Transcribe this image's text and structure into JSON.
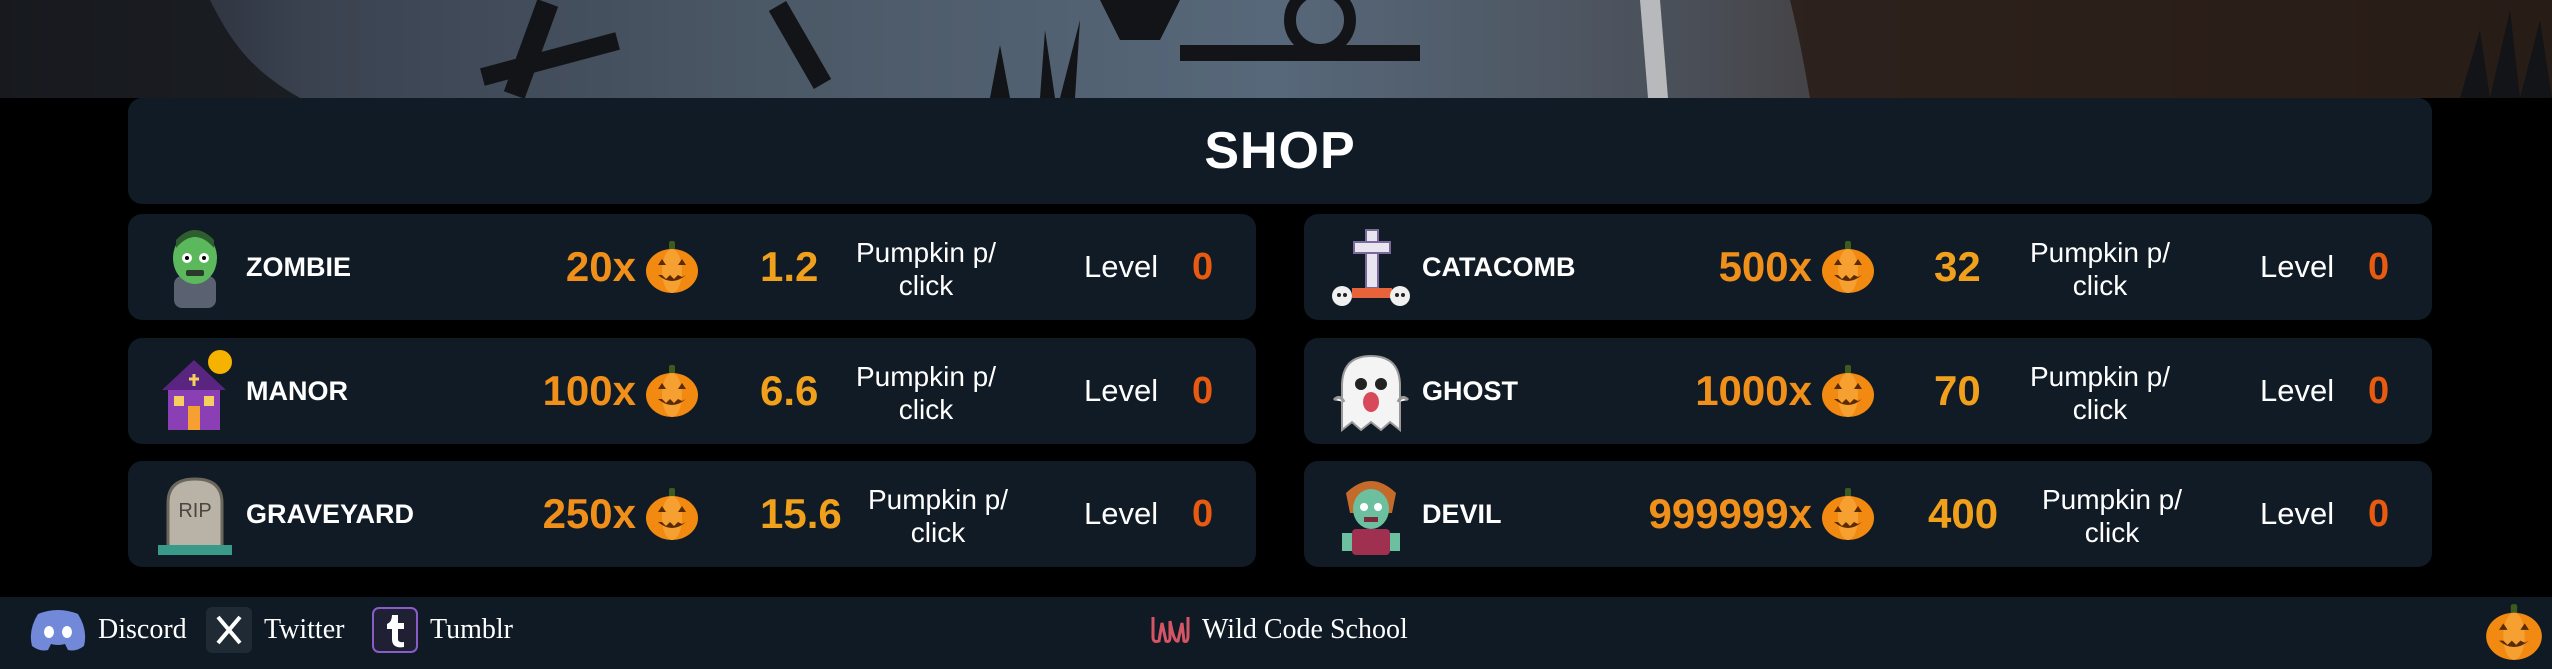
{
  "colors": {
    "panel": "#111b25",
    "cost": "#f0901a",
    "rate": "#f0a01a",
    "level": "#e85a10",
    "footer_bg": "#0f1a24"
  },
  "shop": {
    "title": "SHOP"
  },
  "items": [
    {
      "name": "ZOMBIE",
      "cost": "20x",
      "rate": "1.2",
      "rate_label": "Pumpkin p/ click",
      "level_label": "Level",
      "level": "0",
      "icon": "zombie-icon"
    },
    {
      "name": "MANOR",
      "cost": "100x",
      "rate": "6.6",
      "rate_label": "Pumpkin p/ click",
      "level_label": "Level",
      "level": "0",
      "icon": "haunted-house-icon"
    },
    {
      "name": "GRAVEYARD",
      "cost": "250x",
      "rate": "15.6",
      "rate_label": "Pumpkin p/ click",
      "level_label": "Level",
      "level": "0",
      "icon": "tombstone-icon"
    },
    {
      "name": "CATACOMB",
      "cost": "500x",
      "rate": "32",
      "rate_label": "Pumpkin p/ click",
      "level_label": "Level",
      "level": "0",
      "icon": "cross-skulls-icon"
    },
    {
      "name": "GHOST",
      "cost": "1000x",
      "rate": "70",
      "rate_label": "Pumpkin p/ click",
      "level_label": "Level",
      "level": "0",
      "icon": "ghost-icon"
    },
    {
      "name": "DEVIL",
      "cost": "999999x",
      "rate": "400",
      "rate_label": "Pumpkin p/ click",
      "level_label": "Level",
      "level": "0",
      "icon": "devil-zombie-icon"
    }
  ],
  "footer": {
    "discord": "Discord",
    "twitter": "Twitter",
    "tumblr": "Tumblr",
    "school": "Wild Code School"
  }
}
